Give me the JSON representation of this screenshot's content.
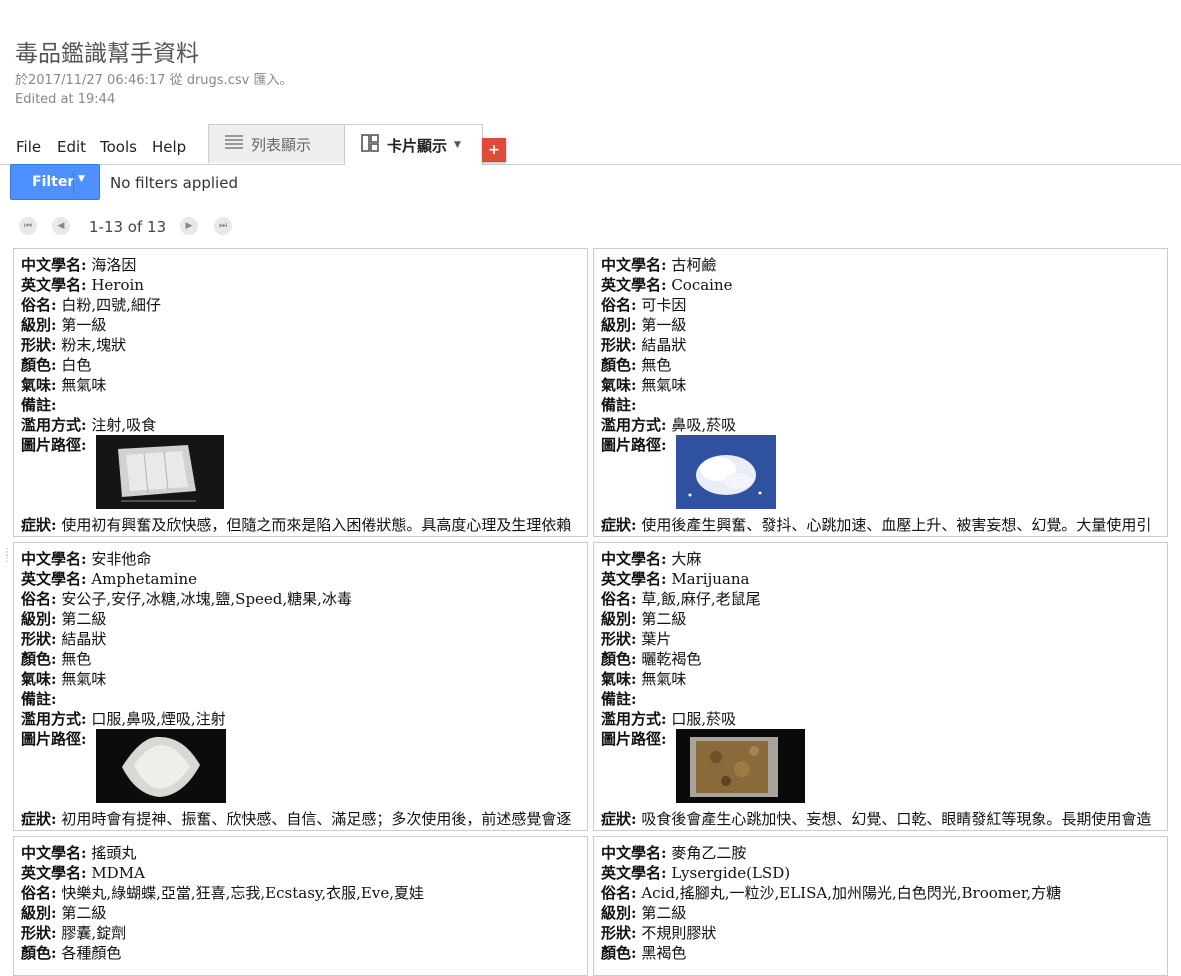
{
  "doc": {
    "title": "毒品鑑識幫手資料",
    "imported": "於2017/11/27 06:46:17 從 drugs.csv 匯入。",
    "edited": "Edited at 19:44"
  },
  "menu": [
    "File",
    "Edit",
    "Tools",
    "Help"
  ],
  "tabs": {
    "list_label": "列表顯示",
    "card_label": "卡片顯示"
  },
  "add_button": "+",
  "filter": {
    "label": "Filter",
    "status": "No filters applied"
  },
  "pager": {
    "range": "1-13 of 13"
  },
  "field_labels": {
    "cn": "中文學名:",
    "en": "英文學名:",
    "alias": "俗名:",
    "level": "級別:",
    "form": "形狀:",
    "color": "顏色:",
    "smell": "氣味:",
    "note": "備註:",
    "abuse": "濫用方式:",
    "image": "圖片路徑:",
    "symptom": "症狀:"
  },
  "cards": [
    {
      "cn": "海洛因",
      "en": "Heroin",
      "alias": "白粉,四號,細仔",
      "level": "第一級",
      "form": "粉末,塊狀",
      "color": "白色",
      "smell": "無氣味",
      "note": "",
      "abuse": "注射,吸食",
      "image_desc": "bag-of-white-powder",
      "symptom": "使用初有興奮及欣快感，但隨之而來是陷入困倦狀態。具高度心理及生理依賴性，長期使用後停藥會發生渴求藥物、不安、打呵欠、流淚、流汗、流鼻水等戒斷症狀。"
    },
    {
      "cn": "古柯鹼",
      "en": "Cocaine",
      "alias": "可卡因",
      "level": "第一級",
      "form": "結晶狀",
      "color": "無色",
      "smell": "無氣味",
      "note": "",
      "abuse": "鼻吸,菸吸",
      "image_desc": "white-powder-pile-on-blue",
      "symptom": "使用後產生興奮、發抖、心跳加速、血壓上升、被害妄想、幻覺。大量使用引起精神錯亂及腦中風，長期使用引起失眠、嗅覺減退、鼻中隔穿孔等。"
    },
    {
      "cn": "安非他命",
      "en": "Amphetamine",
      "alias": "安公子,安仔,冰糖,冰塊,鹽,Speed,糖果,冰毒",
      "level": "第二級",
      "form": "結晶狀",
      "color": "無色",
      "smell": "無氣味",
      "note": "",
      "abuse": "口服,鼻吸,煙吸,注射",
      "image_desc": "bag-of-crystals",
      "symptom": "初用時會有提神、振奮、欣快感、自信、滿足感；多次使用後，前述感覺會逐漸減輕或消失，不用時會感覺無力、沮喪、情緒低落而致使用量及頻率增加。"
    },
    {
      "cn": "大麻",
      "en": "Marijuana",
      "alias": "草,飯,麻仔,老鼠尾",
      "level": "第二級",
      "form": "葉片",
      "color": "曬乾褐色",
      "smell": "無氣味",
      "note": "",
      "abuse": "口服,菸吸",
      "image_desc": "dried-brown-leaves",
      "symptom": "吸食後會產生心跳加快、妄想、幻覺、口乾、眼睛發紅等現象。長期使用會造成記憶、學習及認知能力減退，體重增加、免疫力降低、不孕症、精子數目減少。"
    },
    {
      "cn": "搖頭丸",
      "en": "MDMA",
      "alias": "快樂丸,綠蝴蝶,亞當,狂喜,忘我,Ecstasy,衣服,Eve,夏娃",
      "level": "第二級",
      "form": "膠囊,錠劑",
      "color": "各種顏色",
      "smell": "",
      "note": "",
      "abuse": "",
      "image_desc": "",
      "symptom": ""
    },
    {
      "cn": "麥角乙二胺",
      "en": "Lysergide(LSD)",
      "alias": "Acid,搖腳丸,一粒沙,ELISA,加州陽光,白色閃光,Broomer,方糖",
      "level": "第二級",
      "form": "不規則膠狀",
      "color": "黑褐色",
      "smell": "",
      "note": "",
      "abuse": "",
      "image_desc": "",
      "symptom": ""
    }
  ]
}
